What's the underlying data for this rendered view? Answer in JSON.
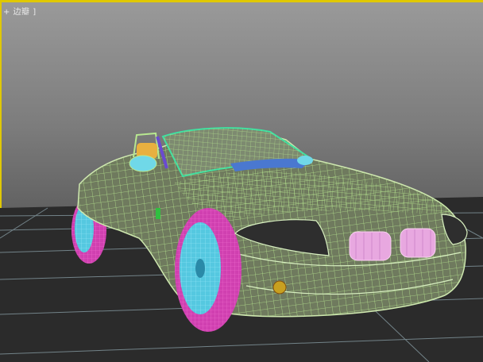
{
  "viewport": {
    "label": "+ 边瓣 ]",
    "active_border_color": "#e0c800"
  },
  "colors": {
    "background_top": "#9a9a9a",
    "floor": "#2b2b2b",
    "grid_line": "#8aa0a8",
    "body_wire": "#b8e890",
    "body_fill": "#6f7a5e",
    "tire": "#d040b0",
    "rim": "#55c8e0",
    "headlight": "#2e2e2e",
    "kidney_grille": "#e8a8e0",
    "windshield_frame": "#40e0a0",
    "seat": "#e8b040",
    "foglight": "#c8a020",
    "mirror": "#70d8e8"
  },
  "icons": {
    "car_model": "car-wireframe-icon"
  }
}
